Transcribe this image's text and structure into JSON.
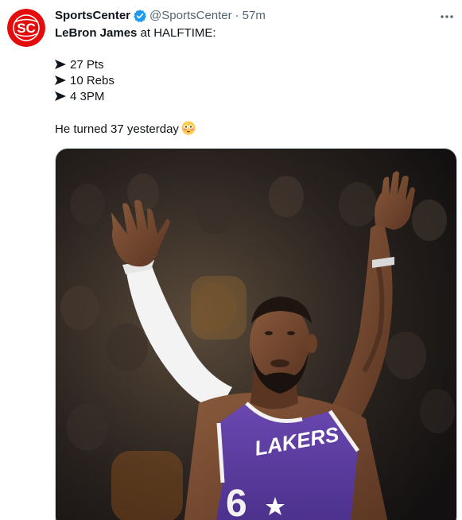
{
  "author": {
    "display_name": "SportsCenter",
    "handle": "@SportsCenter",
    "separator": "·",
    "time": "57m",
    "avatar_icon": "sportscenter-logo",
    "verified_icon": "verified-badge-icon",
    "brand_color": "#e40d0d",
    "verified_color": "#1d9bf0"
  },
  "tweet": {
    "name": "LeBron James",
    "headline_rest": " at HALFTIME:",
    "stats": [
      {
        "bullet_icon": "right-arrow-icon",
        "text": "27 Pts"
      },
      {
        "bullet_icon": "right-arrow-icon",
        "text": "10 Rebs"
      },
      {
        "bullet_icon": "right-arrow-icon",
        "text": "4 3PM"
      }
    ],
    "closing_text": "He turned 37 yesterday",
    "closing_emoji": "flushed-face-emoji"
  },
  "media": {
    "jersey_text": "LAKERS",
    "jersey_number": "6",
    "jersey_color": "#55379c",
    "trim_color": "#f2f2f2"
  },
  "menu": {
    "more_icon": "more-options-icon"
  }
}
